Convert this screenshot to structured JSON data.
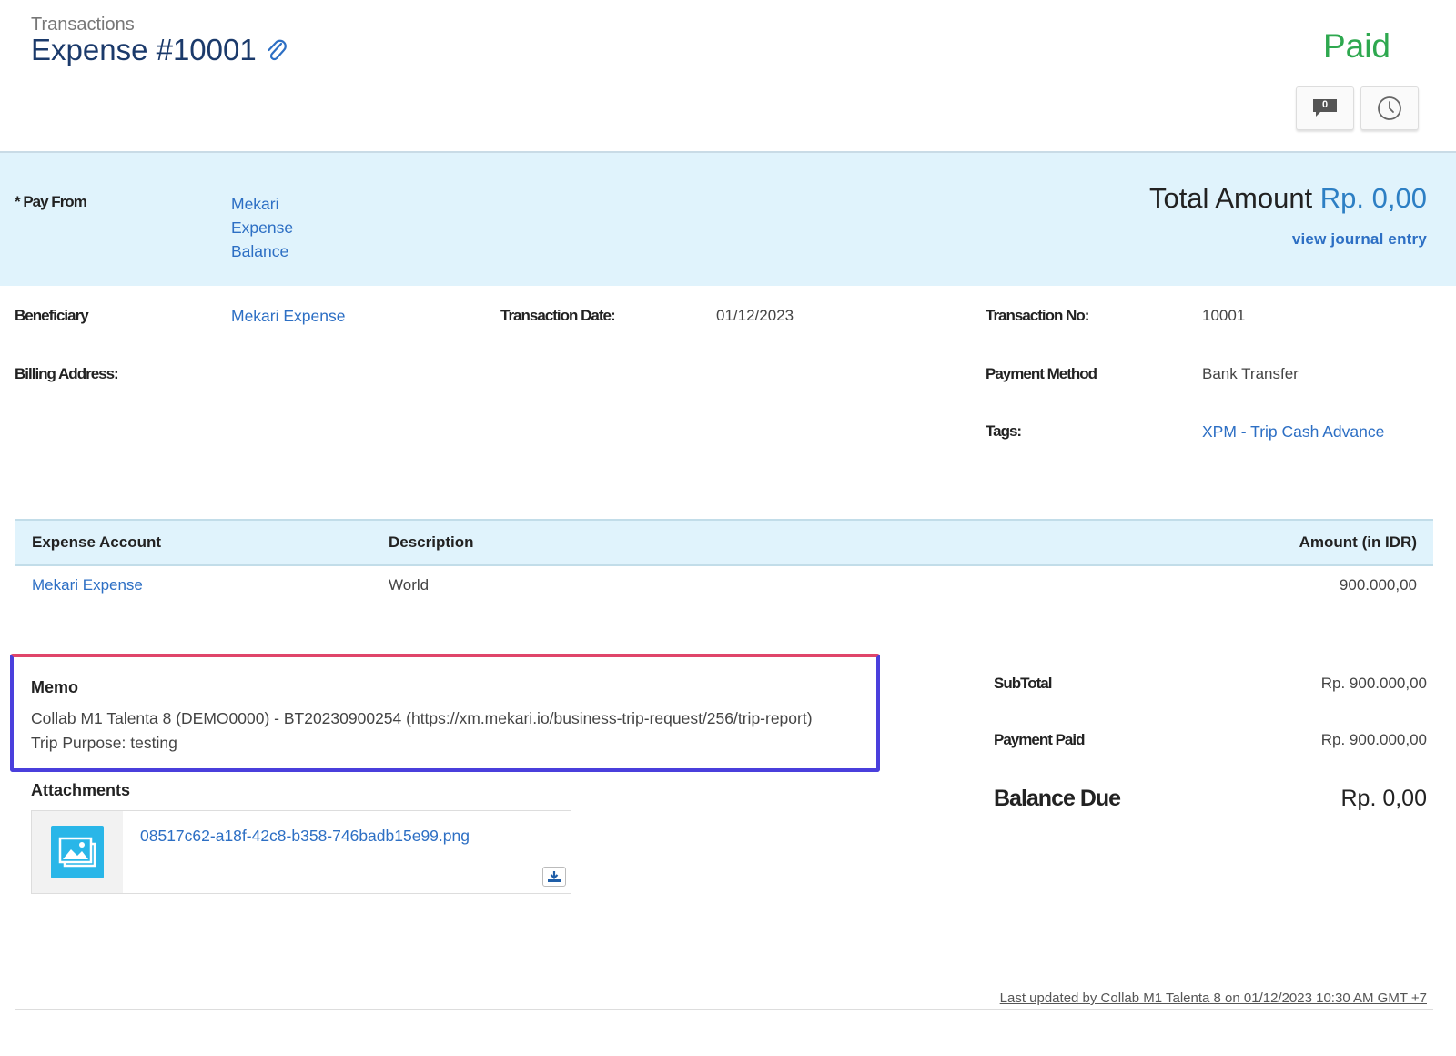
{
  "header": {
    "breadcrumb": "Transactions",
    "title": "Expense #10001",
    "status": "Paid",
    "comment_count": "0"
  },
  "pay_from": {
    "label": "* Pay From",
    "account_lines": [
      "Mekari",
      "Expense",
      "Balance"
    ]
  },
  "total": {
    "label": "Total Amount ",
    "amount": "Rp. 0,00",
    "journal_link": "view journal entry"
  },
  "details": {
    "beneficiary_label": "Beneficiary",
    "beneficiary_value": "Mekari Expense",
    "transaction_date_label": "Transaction Date:",
    "transaction_date_value": "01/12/2023",
    "transaction_no_label": "Transaction No:",
    "transaction_no_value": "10001",
    "billing_address_label": "Billing Address:",
    "payment_method_label": "Payment Method",
    "payment_method_value": "Bank Transfer",
    "tags_label": "Tags:",
    "tags_value": "XPM - Trip Cash Advance"
  },
  "table": {
    "headers": [
      "Expense Account",
      "Description",
      "Amount (in IDR)"
    ],
    "rows": [
      {
        "account": "Mekari Expense",
        "description": "World",
        "amount": "900.000,00"
      }
    ]
  },
  "memo": {
    "title": "Memo",
    "line1": "Collab M1 Talenta 8 (DEMO0000) - BT20230900254 (https://xm.mekari.io/business-trip-request/256/trip-report)",
    "line2": "Trip Purpose: testing"
  },
  "attachments": {
    "title": "Attachments",
    "files": [
      {
        "name": "08517c62-a18f-42c8-b358-746badb15e99.png"
      }
    ]
  },
  "totals": {
    "subtotal_label": "SubTotal",
    "subtotal_value": "Rp. 900.000,00",
    "payment_paid_label": "Payment Paid",
    "payment_paid_value": "Rp. 900.000,00",
    "balance_due_label": "Balance Due",
    "balance_due_value": "Rp. 0,00"
  },
  "footer": {
    "last_updated": "Last updated by Collab M1 Talenta 8 on 01/12/2023 10:30 AM GMT +7"
  },
  "colors": {
    "paid_status": "#2ea84f",
    "link": "#2d6fc4",
    "panel_bg": "#e0f3fc",
    "title": "#1b3a6b",
    "memo_highlight": "#4a3fdc"
  },
  "icons": [
    "paperclip-icon",
    "comment-icon",
    "history-clock-icon",
    "image-file-icon",
    "download-icon"
  ]
}
